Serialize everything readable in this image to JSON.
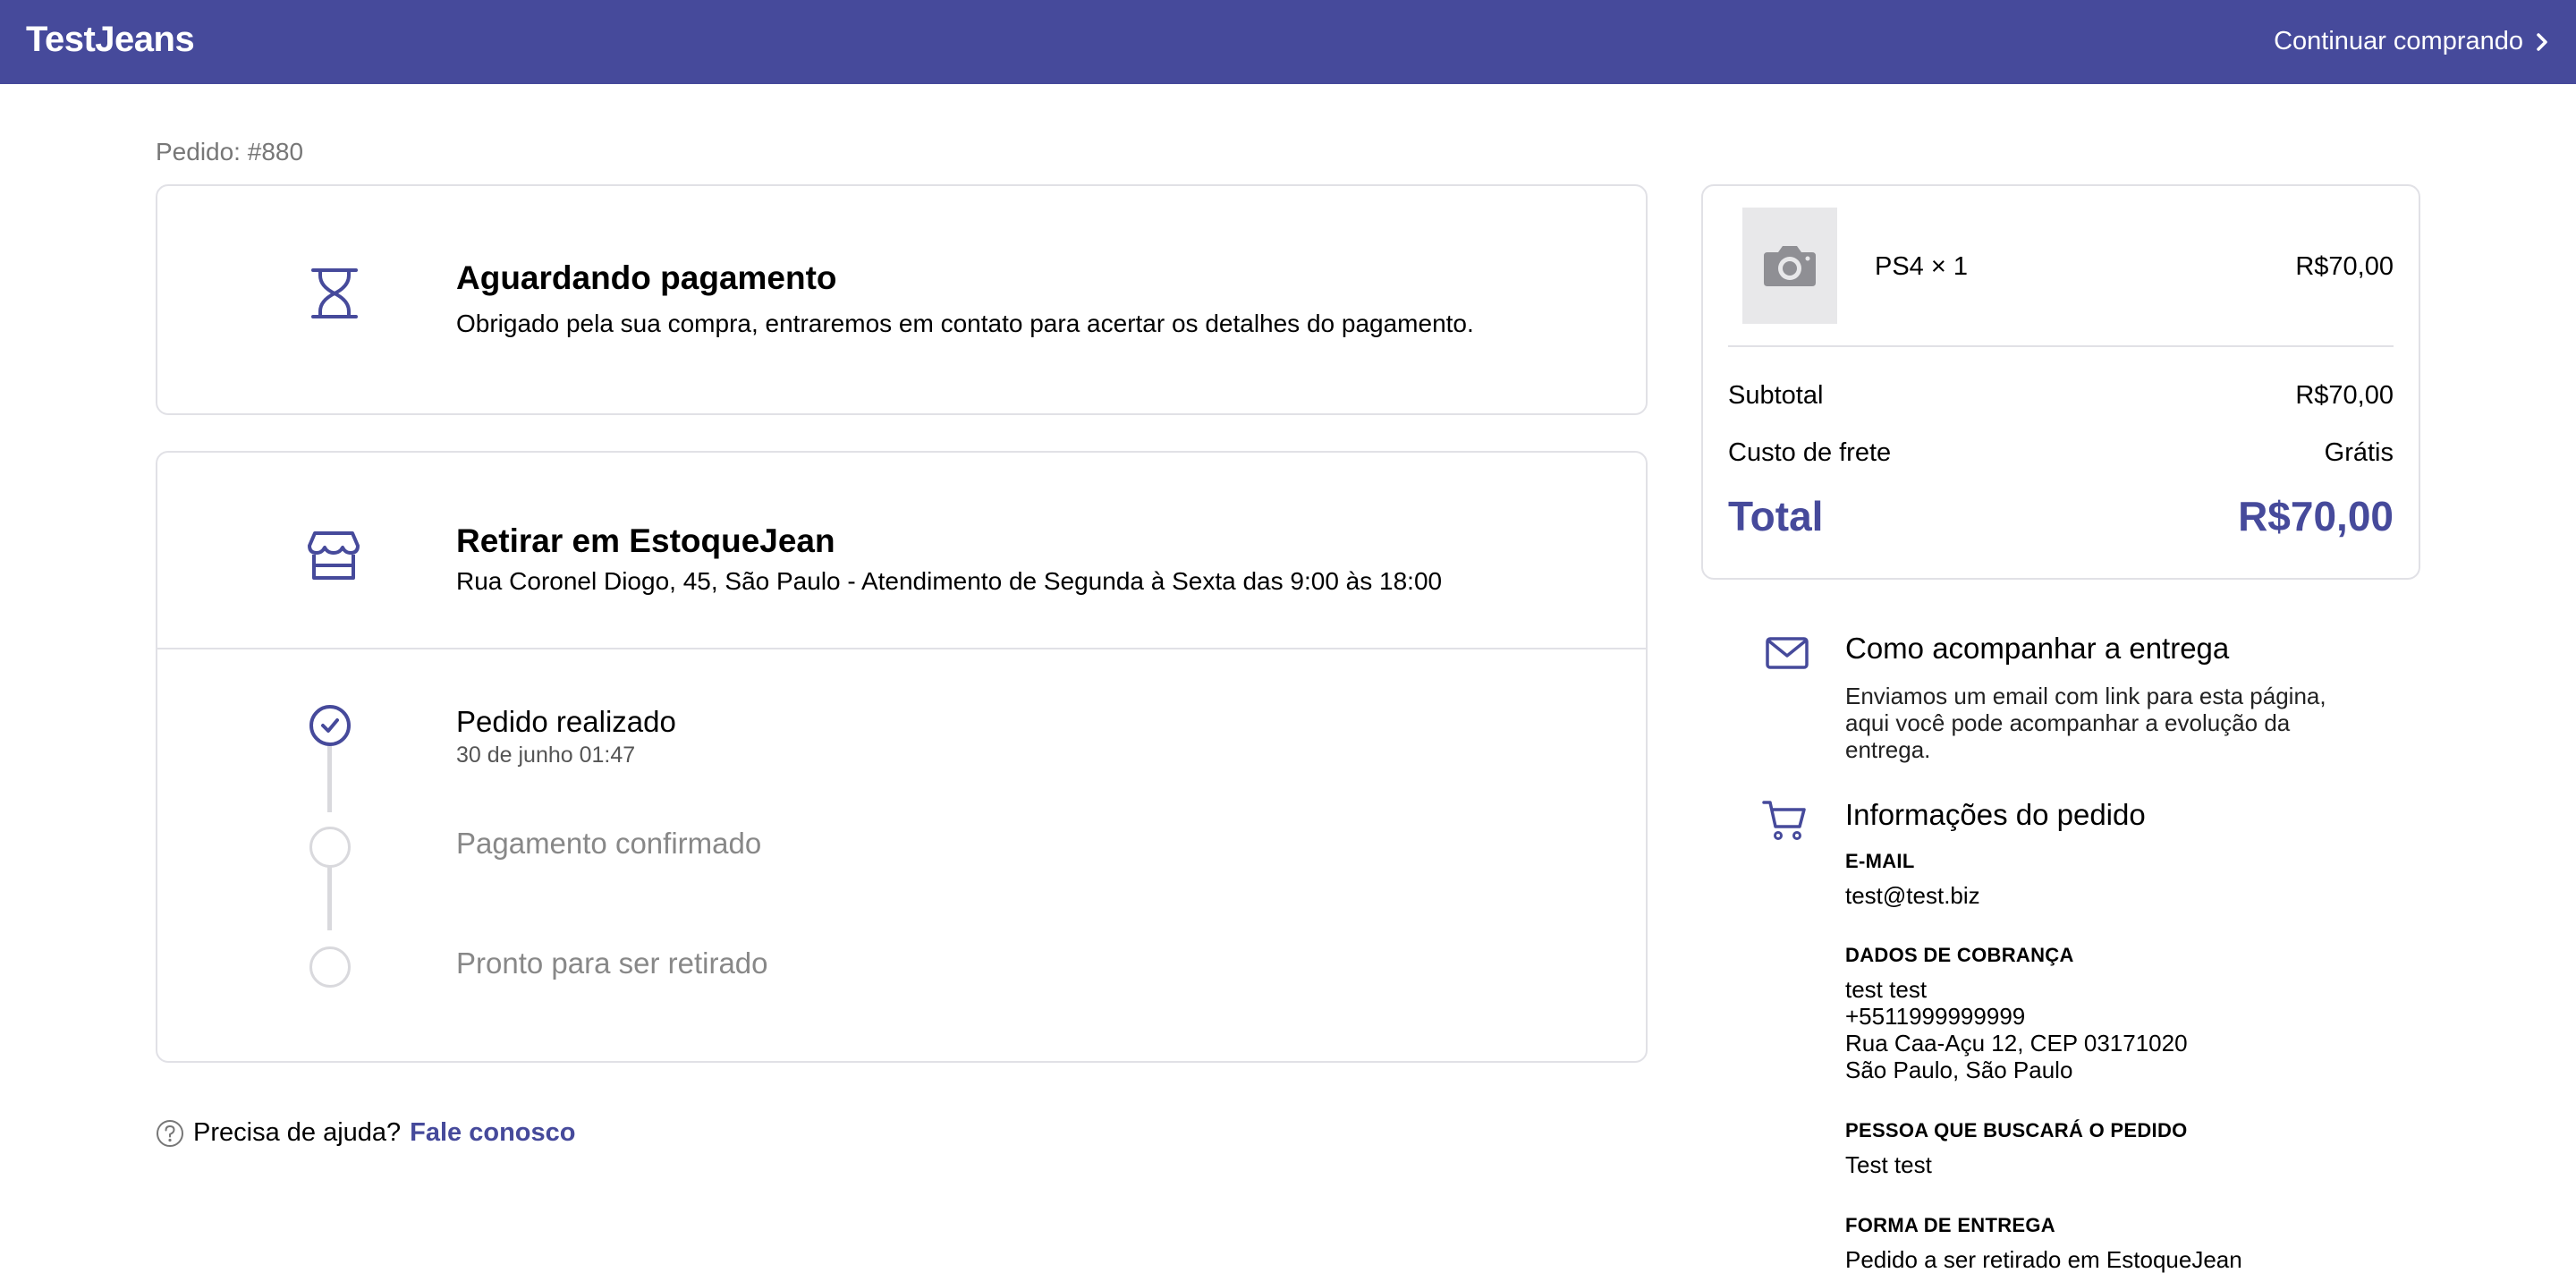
{
  "header": {
    "brand": "TestJeans",
    "continue_label": "Continuar comprando"
  },
  "order": {
    "number_label": "Pedido: #880"
  },
  "status_card": {
    "icon": "hourglass-icon",
    "title": "Aguardando pagamento",
    "description": "Obrigado pela sua compra, entraremos em contato para acertar os detalhes do pagamento."
  },
  "pickup_card": {
    "icon": "store-icon",
    "title": "Retirar em EstoqueJean",
    "address": "Rua Coronel Diogo, 45, São Paulo - Atendimento de Segunda à Sexta das 9:00 às 18:00",
    "steps": [
      {
        "label": "Pedido realizado",
        "date": "30 de junho 01:47",
        "done": true
      },
      {
        "label": "Pagamento confirmado",
        "date": "",
        "done": false
      },
      {
        "label": "Pronto para ser retirado",
        "date": "",
        "done": false
      }
    ]
  },
  "help": {
    "text": "Precisa de ajuda?",
    "link": "Fale conosco"
  },
  "summary": {
    "item_name": "PS4 × 1",
    "item_price": "R$70,00",
    "subtotal_label": "Subtotal",
    "subtotal_value": "R$70,00",
    "shipping_label": "Custo de frete",
    "shipping_value": "Grátis",
    "total_label": "Total",
    "total_value": "R$70,00"
  },
  "tracking": {
    "title": "Como acompanhar a entrega",
    "lines": [
      "Enviamos um email com link para esta página,",
      "aqui você pode acompanhar a evolução da",
      "entrega."
    ]
  },
  "order_info": {
    "title": "Informações do pedido",
    "email_label": "E-MAIL",
    "email": "test@test.biz",
    "billing_label": "DADOS DE COBRANÇA",
    "billing_lines": [
      "test test",
      "+5511999999999",
      "Rua Caa-Açu 12, CEP 03171020",
      "São Paulo, São Paulo"
    ],
    "pickup_person_label": "PESSOA QUE BUSCARÁ O PEDIDO",
    "pickup_person": "Test test",
    "delivery_label": "FORMA DE ENTREGA",
    "delivery_value": "Pedido a ser retirado em EstoqueJean"
  },
  "colors": {
    "brand": "#464a9b",
    "border": "#e1e1e6",
    "muted": "#888888"
  }
}
